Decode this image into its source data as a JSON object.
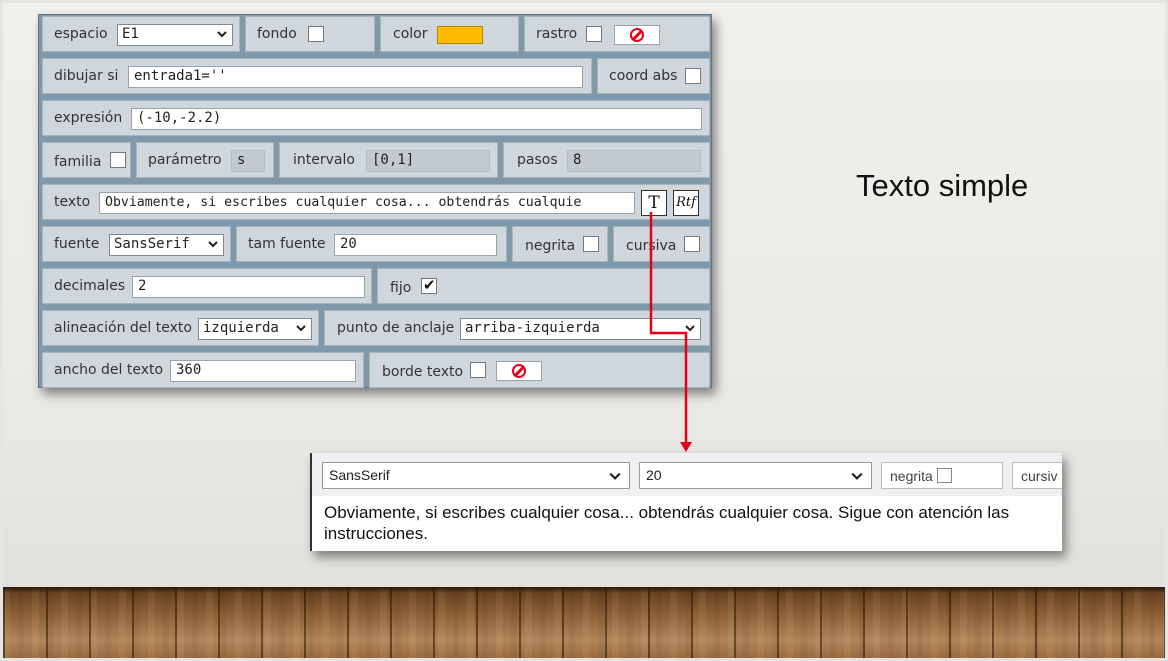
{
  "slide": {
    "title": "Texto simple"
  },
  "dialog": {
    "row1": {
      "espacio_label": "espacio",
      "espacio_value": "E1",
      "fondo_label": "fondo",
      "color_label": "color",
      "color_hex": "#ffbb00",
      "rastro_label": "rastro"
    },
    "row2": {
      "dibujar_label": "dibujar si",
      "dibujar_value": "entrada1=''",
      "coord_label": "coord abs"
    },
    "row3": {
      "expresion_label": "expresión",
      "expresion_value": "(-10,-2.2)"
    },
    "row4": {
      "familia_label": "familia",
      "parametro_label": "parámetro",
      "parametro_value": "s",
      "intervalo_label": "intervalo",
      "intervalo_value": "[0,1]",
      "pasos_label": "pasos",
      "pasos_value": "8"
    },
    "row5": {
      "texto_label": "texto",
      "texto_value": "Obviamente, si escribes cualquier cosa... obtendrás cualquie",
      "simple_btn": "T",
      "rtf_btn": "Rtf"
    },
    "row6": {
      "fuente_label": "fuente",
      "fuente_value": "SansSerif",
      "tam_label": "tam fuente",
      "tam_value": "20",
      "negrita_label": "negrita",
      "cursiva_label": "cursiva"
    },
    "row7": {
      "decimales_label": "decimales",
      "decimales_value": "2",
      "fijo_label": "fijo",
      "fijo_checked": true
    },
    "row8": {
      "alineacion_label": "alineación del texto",
      "alineacion_value": "izquierda",
      "anclaje_label": "punto de anclaje",
      "anclaje_value": "arriba-izquierda"
    },
    "row9": {
      "ancho_label": "ancho del texto",
      "ancho_value": "360",
      "borde_label": "borde texto"
    }
  },
  "zoom": {
    "font_value": "SansSerif",
    "size_value": "20",
    "negrita_label": "negrita",
    "cursiva_label": "cursiv",
    "text_value": "Obviamente, si escribes cualquier cosa... obtendrás cualquier cosa. Sigue con atención las instrucciones."
  },
  "colors": {
    "accent_red": "#e2001a",
    "dialog_bg": "#7f98aa",
    "cell_bg": "#cfd6dc"
  },
  "icons": [
    "chevron-down-icon",
    "no-symbol-icon",
    "checkmark-icon"
  ]
}
